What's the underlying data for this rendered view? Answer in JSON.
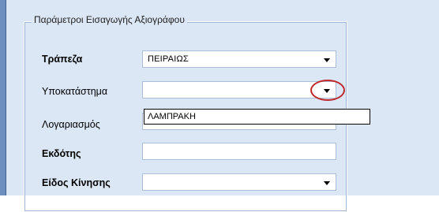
{
  "group": {
    "title": "Παράμετροι Εισαγωγής Αξιογράφου"
  },
  "fields": {
    "bank": {
      "label": "Τράπεζα",
      "value": "ΠΕΙΡΑΙΩΣ"
    },
    "branch": {
      "label": "Υποκατάστημα",
      "value": ""
    },
    "account": {
      "label": "Λογαριασμός",
      "value": ""
    },
    "issuer": {
      "label": "Εκδότης",
      "value": ""
    },
    "movement_type": {
      "label": "Είδος Κίνησης",
      "value": ""
    }
  },
  "branch_dropdown": {
    "options": [
      "ΛΑΜΠΡΑΚΗ"
    ]
  },
  "colors": {
    "highlight": "#c0282c",
    "panel": "#dbe7f5"
  },
  "icons": {
    "dropdown_arrow": "chevron-down-icon"
  }
}
